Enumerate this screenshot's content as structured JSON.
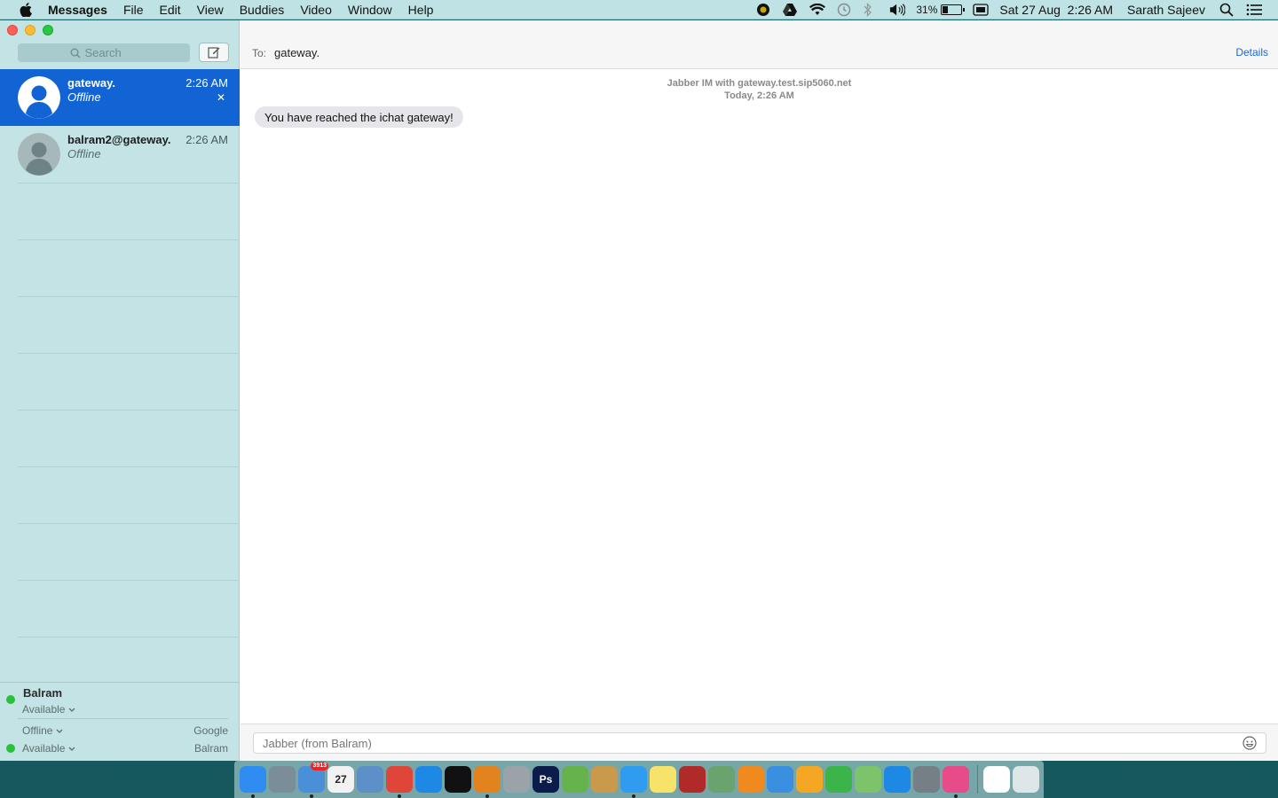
{
  "menubar": {
    "app_name": "Messages",
    "menus": [
      "File",
      "Edit",
      "View",
      "Buddies",
      "Video",
      "Window",
      "Help"
    ],
    "battery_percent": "31%",
    "battery_level": 0.31,
    "datetime": "Sat 27 Aug  2:26 AM",
    "user": "Sarath Sajeev"
  },
  "sidebar": {
    "search_placeholder": "Search",
    "conversations": [
      {
        "name": "gateway.",
        "status": "Offline",
        "time": "2:26 AM",
        "selected": true
      },
      {
        "name": "balram2@gateway.",
        "status": "Offline",
        "time": "2:26 AM",
        "selected": false
      }
    ],
    "account": {
      "name": "Balram",
      "status": "Available",
      "services": [
        {
          "status": "Offline",
          "service": "Google",
          "online": false
        },
        {
          "status": "Available",
          "service": "Balram",
          "online": true
        }
      ]
    }
  },
  "conversation": {
    "to_label": "To:",
    "to_value": "gateway.",
    "details_label": "Details",
    "header_line1": "Jabber IM with gateway.test.sip5060.net",
    "header_line2": "Today, 2:26 AM",
    "messages": [
      {
        "text": "You have reached the ichat gateway!",
        "from": "them"
      }
    ],
    "composer_placeholder": "Jabber (from Balram)"
  },
  "dock": {
    "items": [
      {
        "name": "finder-icon",
        "color": "#2f8cf0",
        "running": true
      },
      {
        "name": "launchpad-icon",
        "color": "#7b8d99",
        "running": false
      },
      {
        "name": "mail-icon",
        "color": "#4a90d9",
        "running": true,
        "badge": "3913"
      },
      {
        "name": "calendar-icon",
        "color": "#f2f2f2",
        "label": "27",
        "running": false
      },
      {
        "name": "preview-icon",
        "color": "#5d8fc9",
        "running": false
      },
      {
        "name": "chrome-icon",
        "color": "#e0453a",
        "running": true
      },
      {
        "name": "safari-icon",
        "color": "#1e88e5",
        "running": false
      },
      {
        "name": "terminal-icon",
        "color": "#111111",
        "running": false
      },
      {
        "name": "vlc-icon",
        "color": "#e2831d",
        "running": true
      },
      {
        "name": "utility-icon",
        "color": "#9aa3a8",
        "running": false
      },
      {
        "name": "photoshop-icon",
        "color": "#0b1c4a",
        "label": "Ps",
        "running": false
      },
      {
        "name": "android-studio-icon",
        "color": "#66b24c",
        "running": false
      },
      {
        "name": "contacts-icon",
        "color": "#c99a4c",
        "running": false
      },
      {
        "name": "messages-icon",
        "color": "#2f9cf0",
        "running": true
      },
      {
        "name": "notes-icon",
        "color": "#f7e36a",
        "running": false
      },
      {
        "name": "photo-booth-icon",
        "color": "#b12a2a",
        "running": false
      },
      {
        "name": "image-capture-icon",
        "color": "#6aa36e",
        "running": false
      },
      {
        "name": "ibooks-icon",
        "color": "#f08a1f",
        "running": false
      },
      {
        "name": "keynote-icon",
        "color": "#3a8fe0",
        "running": false
      },
      {
        "name": "pages-icon",
        "color": "#f5a623",
        "running": false
      },
      {
        "name": "numbers-icon",
        "color": "#3bb54a",
        "running": false
      },
      {
        "name": "maps-icon",
        "color": "#7cc36a",
        "running": false
      },
      {
        "name": "app-store-icon",
        "color": "#1e88e5",
        "running": false
      },
      {
        "name": "system-preferences-icon",
        "color": "#777f86",
        "running": false
      },
      {
        "name": "itunes-icon",
        "color": "#e84b8a",
        "running": true
      }
    ],
    "trailing": [
      {
        "name": "document-icon",
        "color": "#ffffff",
        "running": false
      },
      {
        "name": "trash-icon",
        "color": "#dfe6e8",
        "running": false
      }
    ]
  }
}
